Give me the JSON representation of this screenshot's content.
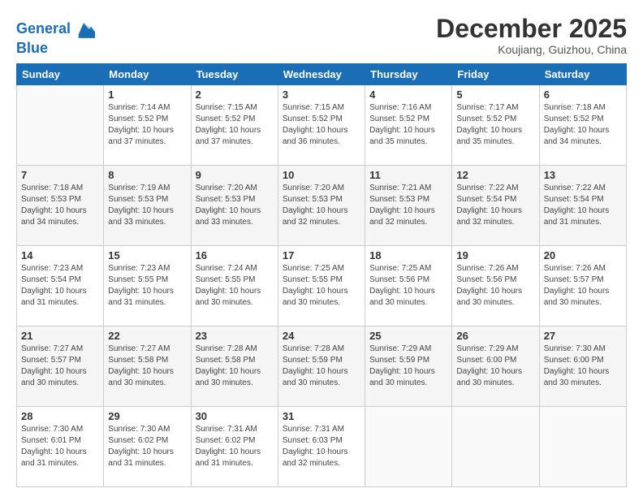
{
  "logo": {
    "line1": "General",
    "line2": "Blue"
  },
  "title": "December 2025",
  "subtitle": "Koujiang, Guizhou, China",
  "days_of_week": [
    "Sunday",
    "Monday",
    "Tuesday",
    "Wednesday",
    "Thursday",
    "Friday",
    "Saturday"
  ],
  "weeks": [
    [
      {
        "num": "",
        "info": ""
      },
      {
        "num": "1",
        "info": "Sunrise: 7:14 AM\nSunset: 5:52 PM\nDaylight: 10 hours\nand 37 minutes."
      },
      {
        "num": "2",
        "info": "Sunrise: 7:15 AM\nSunset: 5:52 PM\nDaylight: 10 hours\nand 37 minutes."
      },
      {
        "num": "3",
        "info": "Sunrise: 7:15 AM\nSunset: 5:52 PM\nDaylight: 10 hours\nand 36 minutes."
      },
      {
        "num": "4",
        "info": "Sunrise: 7:16 AM\nSunset: 5:52 PM\nDaylight: 10 hours\nand 35 minutes."
      },
      {
        "num": "5",
        "info": "Sunrise: 7:17 AM\nSunset: 5:52 PM\nDaylight: 10 hours\nand 35 minutes."
      },
      {
        "num": "6",
        "info": "Sunrise: 7:18 AM\nSunset: 5:52 PM\nDaylight: 10 hours\nand 34 minutes."
      }
    ],
    [
      {
        "num": "7",
        "info": "Sunrise: 7:18 AM\nSunset: 5:53 PM\nDaylight: 10 hours\nand 34 minutes."
      },
      {
        "num": "8",
        "info": "Sunrise: 7:19 AM\nSunset: 5:53 PM\nDaylight: 10 hours\nand 33 minutes."
      },
      {
        "num": "9",
        "info": "Sunrise: 7:20 AM\nSunset: 5:53 PM\nDaylight: 10 hours\nand 33 minutes."
      },
      {
        "num": "10",
        "info": "Sunrise: 7:20 AM\nSunset: 5:53 PM\nDaylight: 10 hours\nand 32 minutes."
      },
      {
        "num": "11",
        "info": "Sunrise: 7:21 AM\nSunset: 5:53 PM\nDaylight: 10 hours\nand 32 minutes."
      },
      {
        "num": "12",
        "info": "Sunrise: 7:22 AM\nSunset: 5:54 PM\nDaylight: 10 hours\nand 32 minutes."
      },
      {
        "num": "13",
        "info": "Sunrise: 7:22 AM\nSunset: 5:54 PM\nDaylight: 10 hours\nand 31 minutes."
      }
    ],
    [
      {
        "num": "14",
        "info": "Sunrise: 7:23 AM\nSunset: 5:54 PM\nDaylight: 10 hours\nand 31 minutes."
      },
      {
        "num": "15",
        "info": "Sunrise: 7:23 AM\nSunset: 5:55 PM\nDaylight: 10 hours\nand 31 minutes."
      },
      {
        "num": "16",
        "info": "Sunrise: 7:24 AM\nSunset: 5:55 PM\nDaylight: 10 hours\nand 30 minutes."
      },
      {
        "num": "17",
        "info": "Sunrise: 7:25 AM\nSunset: 5:55 PM\nDaylight: 10 hours\nand 30 minutes."
      },
      {
        "num": "18",
        "info": "Sunrise: 7:25 AM\nSunset: 5:56 PM\nDaylight: 10 hours\nand 30 minutes."
      },
      {
        "num": "19",
        "info": "Sunrise: 7:26 AM\nSunset: 5:56 PM\nDaylight: 10 hours\nand 30 minutes."
      },
      {
        "num": "20",
        "info": "Sunrise: 7:26 AM\nSunset: 5:57 PM\nDaylight: 10 hours\nand 30 minutes."
      }
    ],
    [
      {
        "num": "21",
        "info": "Sunrise: 7:27 AM\nSunset: 5:57 PM\nDaylight: 10 hours\nand 30 minutes."
      },
      {
        "num": "22",
        "info": "Sunrise: 7:27 AM\nSunset: 5:58 PM\nDaylight: 10 hours\nand 30 minutes."
      },
      {
        "num": "23",
        "info": "Sunrise: 7:28 AM\nSunset: 5:58 PM\nDaylight: 10 hours\nand 30 minutes."
      },
      {
        "num": "24",
        "info": "Sunrise: 7:28 AM\nSunset: 5:59 PM\nDaylight: 10 hours\nand 30 minutes."
      },
      {
        "num": "25",
        "info": "Sunrise: 7:29 AM\nSunset: 5:59 PM\nDaylight: 10 hours\nand 30 minutes."
      },
      {
        "num": "26",
        "info": "Sunrise: 7:29 AM\nSunset: 6:00 PM\nDaylight: 10 hours\nand 30 minutes."
      },
      {
        "num": "27",
        "info": "Sunrise: 7:30 AM\nSunset: 6:00 PM\nDaylight: 10 hours\nand 30 minutes."
      }
    ],
    [
      {
        "num": "28",
        "info": "Sunrise: 7:30 AM\nSunset: 6:01 PM\nDaylight: 10 hours\nand 31 minutes."
      },
      {
        "num": "29",
        "info": "Sunrise: 7:30 AM\nSunset: 6:02 PM\nDaylight: 10 hours\nand 31 minutes."
      },
      {
        "num": "30",
        "info": "Sunrise: 7:31 AM\nSunset: 6:02 PM\nDaylight: 10 hours\nand 31 minutes."
      },
      {
        "num": "31",
        "info": "Sunrise: 7:31 AM\nSunset: 6:03 PM\nDaylight: 10 hours\nand 32 minutes."
      },
      {
        "num": "",
        "info": ""
      },
      {
        "num": "",
        "info": ""
      },
      {
        "num": "",
        "info": ""
      }
    ]
  ]
}
